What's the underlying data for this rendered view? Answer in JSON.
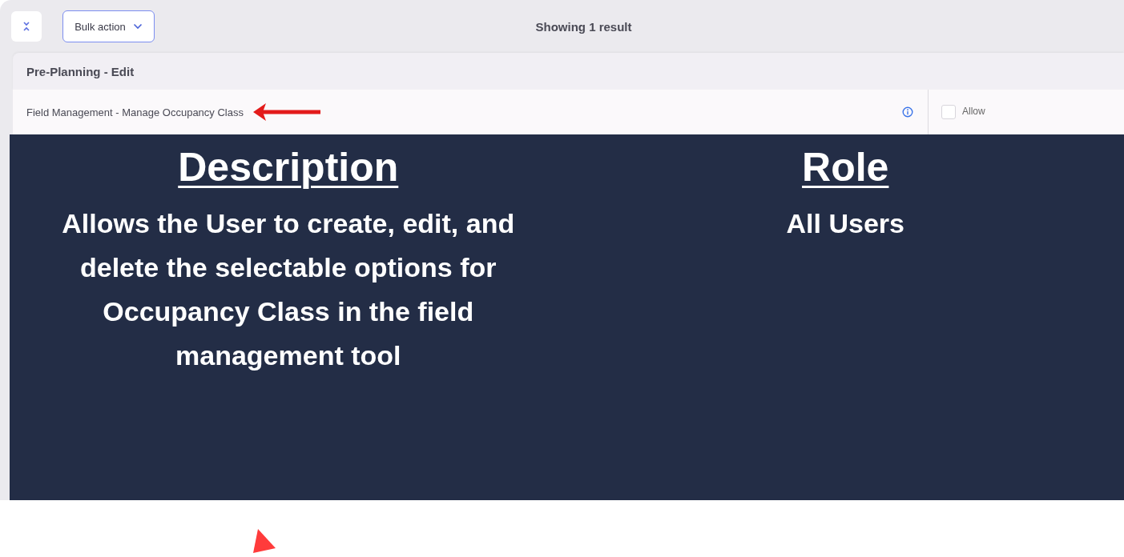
{
  "toolbar": {
    "bulk_action": "Bulk action",
    "result_count": "Showing 1 result"
  },
  "group": {
    "title": "Pre-Planning - Edit"
  },
  "permission": {
    "label": "Field Management - Manage Occupancy Class",
    "checkbox": {
      "label": "Allow",
      "checked": false
    }
  },
  "overlay": {
    "columns": [
      {
        "heading": "Description",
        "text": "Allows the User to create, edit, and delete the selectable options for Occupancy Class in the field management tool"
      },
      {
        "heading": "Role",
        "text": "All Users"
      }
    ]
  }
}
